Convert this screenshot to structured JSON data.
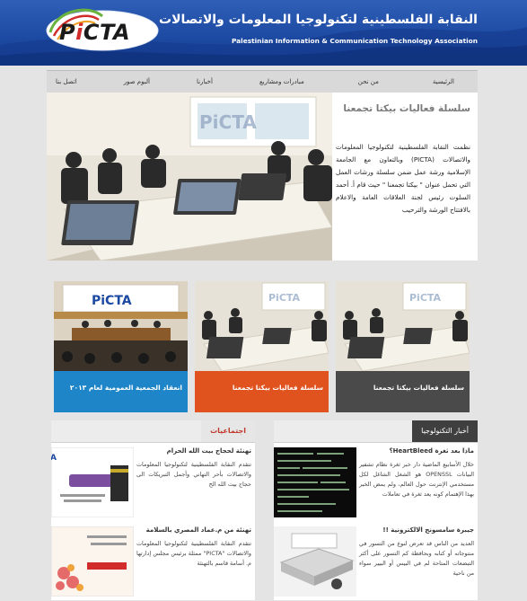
{
  "header": {
    "logo_text": "PiCTA",
    "title_ar": "النقابة الفلسطينية لتكنولوجيا المعلومات والاتصالات",
    "title_en": "Palestinian Information & Communication Technology Association"
  },
  "nav": {
    "items": [
      {
        "label": "الرئيسية"
      },
      {
        "label": "من نحن"
      },
      {
        "label": "مبادرات ومشاريع"
      },
      {
        "label": "أخبارنا"
      },
      {
        "label": "ألبوم صور"
      },
      {
        "label": "اتصل بنا"
      }
    ]
  },
  "hero": {
    "title": "سلسلة فعاليات بيكتا تجمعنا",
    "body": "نظمت النقابة الفلسطينية لتكنولوجيا المعلومات والاتصالات (PICTA) وبالتعاون مع الجامعة الإسلامية ورشة عمل ضمن سلسلة ورشات العمل التي تحمل عنوان \" بيكتا تجمعنا \" حيث قام أ. أحمد السلوت رئيس لجنة العلاقات العامة والاعلام بالافتتاح الورشة والترحيب"
  },
  "cards": [
    {
      "caption": "سلسلة فعاليات بيكتا تجمعنا",
      "color": "#4a4a4a"
    },
    {
      "caption": "سلسلة فعاليات بيكتا تجمعنا",
      "color": "#e0531f"
    },
    {
      "caption": "انعقاد الجمعية العمومية لعام ٢٠١٣",
      "color": "#1e86c8"
    }
  ],
  "panels": {
    "tech": {
      "header": "أخبار التكنولوجيا",
      "items": [
        {
          "title": "ماذا بعد ثغرة HeartBleed؟",
          "desc": "خلال الأسابيع الماضية دار خبر ثغرة نظام تشفير البيانات OPENSSL هو الشغل الشاغل لكل مستخدمي الإنترنت حول العالم، ولم يمض الخبر بهذا الإهتمام كونه يعد ثغرة في تعاملات"
        },
        {
          "title": "جيبرة سامسونج الالكترونية !!",
          "desc": "العديد من الناس قد تعرض لنوع من التسور في منتوجاته أو كتابه وبحافظة كم التسور على أكثر التبضعات المتاحة لم في البيس أو البيير سواء من ناحية"
        }
      ]
    },
    "social": {
      "header": "اجتماعيات",
      "items": [
        {
          "title": "تهنئة لحجاج بيت الله الحرام",
          "desc": "تتقدم النقابة الفلسطينية لتكنولوجيا المعلومات والاتصالات بأحر التهاني وأجمل التبريكات الى حجاج بيت الله الح"
        },
        {
          "title": "تهنئة من م.عماد المصري بالسلامة",
          "desc": "تتقدم النقابة الفلسطينية لتكنولوجيا المعلومات والاتصالات \"PICTA\" ممثلة برئيس مجلس إدارتها م. أسامة قاسم بالتهنئة"
        }
      ]
    }
  },
  "colors": {
    "header_blue": "#1c49a1",
    "nav_gold": "#c9a92a",
    "card_dark": "#4a4a4a",
    "card_orange": "#e0531f",
    "card_blue": "#1e86c8"
  }
}
